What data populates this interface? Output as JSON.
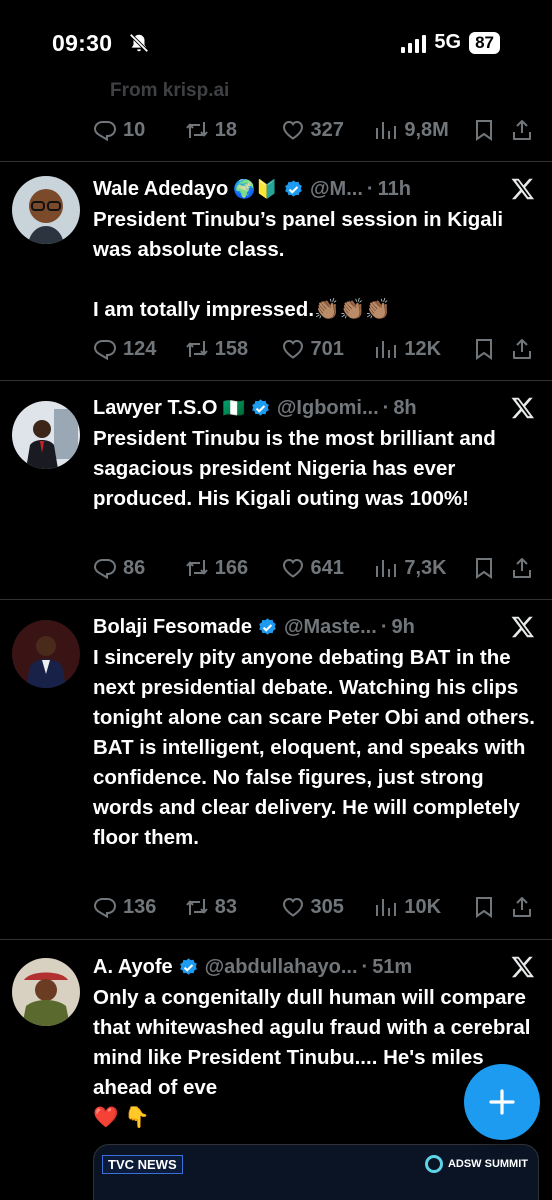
{
  "status_bar": {
    "time": "09:30",
    "network": "5G",
    "battery": "87"
  },
  "partial_tweet": {
    "text": "From krisp.ai",
    "replies": "10",
    "retweets": "18",
    "likes": "327",
    "views": "9,8M"
  },
  "tweets": [
    {
      "name": "Wale Adedayo",
      "handle": "@M...",
      "time": "11h",
      "body": "President Tinubu’s panel session in Kigali was absolute class.\n\nI am totally impressed.👏🏽👏🏽👏🏽",
      "flags": "🌍🔰",
      "replies": "124",
      "retweets": "158",
      "likes": "701",
      "views": "12K"
    },
    {
      "name": "Lawyer T.S.O",
      "handle": "@Igbomi...",
      "time": "8h",
      "body": "President Tinubu is the most brilliant and sagacious president Nigeria has ever produced. His Kigali outing was 100%!",
      "flags": "🇳🇬",
      "replies": "86",
      "retweets": "166",
      "likes": "641",
      "views": "7,3K"
    },
    {
      "name": "Bolaji Fesomade",
      "handle": "@Maste...",
      "time": "9h",
      "body": "I sincerely pity anyone debating BAT in the next presidential debate. Watching his clips tonight alone can scare Peter Obi and others. BAT is intelligent, eloquent, and speaks with confidence. No false figures, just strong words and clear delivery. He will completely floor them.",
      "flags": "",
      "replies": "136",
      "retweets": "83",
      "likes": "305",
      "views": "10K"
    },
    {
      "name": "A. Ayofe",
      "handle": "@abdullahayo...",
      "time": "51m",
      "body": "Only a congenitally dull human will compare that whitewashed agulu fraud with a cerebral mind like President Tinubu.... He's miles ahead of eve\n❤️ 👇",
      "flags": ""
    }
  ],
  "media": {
    "left_logo": "TVC NEWS",
    "right_logo": "ADSW SUMMIT"
  },
  "icons": {
    "reply": "reply-icon",
    "retweet": "retweet-icon",
    "like": "like-icon",
    "views": "views-icon",
    "bookmark": "bookmark-icon",
    "share": "share-icon",
    "verified": "verified-badge-icon",
    "x": "x-logo-icon",
    "compose": "compose-plus-icon"
  },
  "colors": {
    "background": "#000000",
    "accent": "#1d9bf0",
    "muted": "#71767b",
    "divider": "#2f3336"
  }
}
